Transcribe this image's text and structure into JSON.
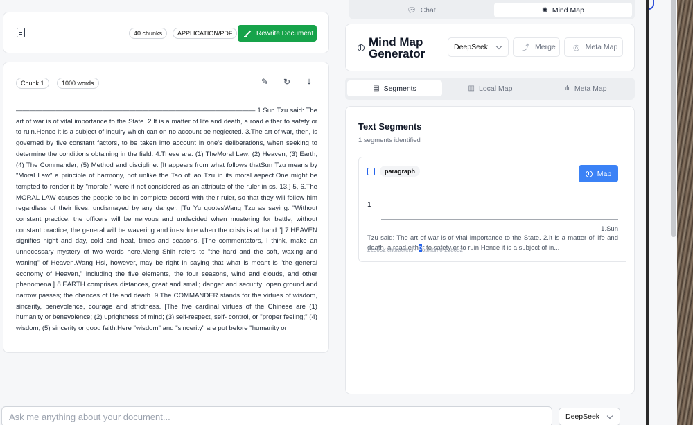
{
  "document": {
    "chunks_badge": "40 chunks",
    "type_badge": "APPLICATION/PDF",
    "rewrite_label": "Rewrite Document"
  },
  "chunk": {
    "label": "Chunk 1",
    "words": "1000 words",
    "text": "———————————————————————————————————— 1.Sun Tzu said: The art of war is of vital importance to the State. 2.It is a matter of life and death, a road either to safety or to ruin.Hence it is a subject of inquiry which can on no account be neglected. 3.The art of war, then, is governed by five constant factors, to be taken into account in one's deliberations, when seeking to determine the conditions obtaining in the field. 4.These are: (1) TheMoral Law; (2) Heaven; (3) Earth; (4) The Commander; (5) Method and discipline. [It appears from what follows thatSun Tzu means by \"Moral Law\" a principle of harmony, not unlike the Tao ofLao Tzu in its moral aspect.One might be tempted to render it by \"morale,\" were it not considered as an attribute of the ruler in ss. 13.] 5, 6.The MORAL LAW causes the people to be in complete accord with their ruler, so that they will follow him regardless of their lives, undismayed by any danger. [Tu Yu quotesWang Tzu as saying: \"Without constant practice, the officers will be nervous and undecided when mustering for battle; without constant practice, the general will be wavering and irresolute when the crisis is at hand.\"] 7.HEAVEN signifies night and day, cold and heat, times and seasons. [The commentators, I think, make an unnecessary mystery of two words here.Meng Shih refers to \"the hard and the soft, waxing and waning\" of Heaven.Wang Hsi, however, may be right in saying that what is meant is \"the general economy of Heaven,\" including the five elements, the four seasons, wind and clouds, and other phenomena.] 8.EARTH comprises distances, great and small; danger and security; open ground and narrow passes; the chances of life and death. 9.The COMMANDER stands for the virtues of wisdom, sincerity, benevolence, courage and strictness. [The five cardinal virtues of the Chinese are (1) humanity or benevolence; (2) uprightness of mind; (3) self-respect, self- control, or \"proper feeling;\" (4) wisdom; (5) sincerity or good faith.Here \"wisdom\" and \"sincerity\" are put before \"humanity or"
  },
  "top_tabs": {
    "chat": "Chat",
    "mind_map": "Mind Map"
  },
  "mindmap": {
    "title_line1": "Mind Map",
    "title_line2": "Generator",
    "model": "DeepSeek",
    "merge": "Merge",
    "meta_map": "Meta Map"
  },
  "sub_tabs": {
    "segments": "Segments",
    "local_map": "Local Map",
    "meta_map": "Meta Map"
  },
  "segments": {
    "title": "Text Segments",
    "count": "1 segments identified",
    "card": {
      "type_badge": "paragraph",
      "map_label": "Map",
      "number": "1",
      "excerpt_line1": "———————————————————————————————————— 1.Sun",
      "excerpt_a": "Tzu said: The art of war is of vital importance to the State. 2.It is a matter of life and death, a road eith",
      "excerpt_hl": "e",
      "excerpt_b": "r to safety or to ruin.Hence it is a subject of in...",
      "meta": "228052 characters • Position 0-228052"
    }
  },
  "chat": {
    "placeholder": "Ask me anything about your document...",
    "model": "DeepSeek"
  }
}
